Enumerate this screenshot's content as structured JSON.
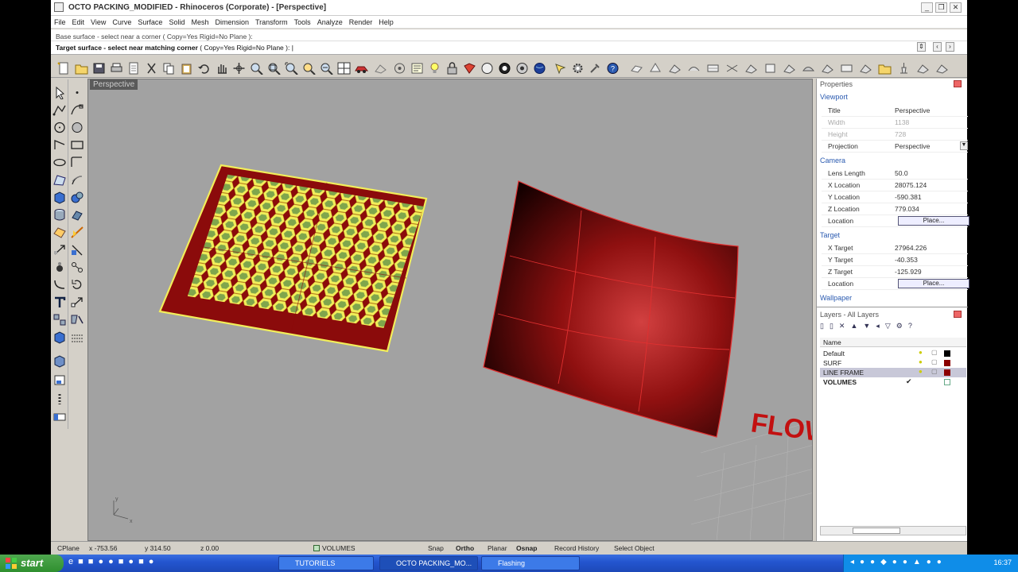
{
  "window": {
    "title": "OCTO PACKING_MODIFIED - Rhinoceros (Corporate) - [Perspective]",
    "controls": [
      "_",
      "❐",
      "✕"
    ]
  },
  "menu": [
    "File",
    "Edit",
    "View",
    "Curve",
    "Surface",
    "Solid",
    "Mesh",
    "Dimension",
    "Transform",
    "Tools",
    "Analyze",
    "Render",
    "Help"
  ],
  "command": {
    "history": "Base surface - select near a corner ( Copy=Yes  Rigid=No  Plane ):",
    "prompt_bold": "Target surface - select near matching corner",
    "prompt_rest": " ( Copy=Yes  Rigid=No  Plane ):"
  },
  "viewport": {
    "label": "Perspective",
    "text3d": "FLOW",
    "axis_x": "x",
    "axis_y": "y"
  },
  "properties": {
    "header": "Properties",
    "viewport_section": "Viewport",
    "title_label": "Title",
    "title_value": "Perspective",
    "width_label": "Width",
    "width_value": "1138",
    "height_label": "Height",
    "height_value": "728",
    "projection_label": "Projection",
    "projection_value": "Perspective",
    "camera_section": "Camera",
    "lens_label": "Lens Length",
    "lens_value": "50.0",
    "xloc_label": "X Location",
    "xloc_value": "28075.124",
    "yloc_label": "Y Location",
    "yloc_value": "-590.381",
    "zloc_label": "Z Location",
    "zloc_value": "779.034",
    "location_label": "Location",
    "place_label": "Place...",
    "target_section": "Target",
    "xtgt_label": "X Target",
    "xtgt_value": "27964.226",
    "ytgt_label": "Y Target",
    "ytgt_value": "-40.353",
    "ztgt_label": "Z Target",
    "ztgt_value": "-125.929",
    "wallpaper_section": "Wallpaper"
  },
  "layers": {
    "header": "Layers - All Layers",
    "name_col": "Name",
    "rows": [
      {
        "name": "Default",
        "color": "#000000"
      },
      {
        "name": "SURF",
        "color": "#8b0000"
      },
      {
        "name": "LINE FRAME",
        "color": "#8b0000"
      },
      {
        "name": "VOLUMES",
        "color": "#ffffff"
      }
    ],
    "current_mark": "✔"
  },
  "status": {
    "cplane": "CPlane",
    "x": "x -753.56",
    "y": "y 314.50",
    "z": "z 0.00",
    "layer": "VOLUMES",
    "snap": "Snap",
    "ortho": "Ortho",
    "planar": "Planar",
    "osnap": "Osnap",
    "record": "Record History",
    "select": "Select Object"
  },
  "taskbar": {
    "start": "start",
    "tasks": [
      "TUTORIELS",
      "OCTO PACKING_MO...",
      "Flashing"
    ],
    "clock": "16:37"
  },
  "colors": {
    "viewport_bg": "#a2a2a2",
    "surface_red": "#8b0000",
    "hex_yellow": "#f2ee5a",
    "hex_green": "#7fa64c",
    "accent_blue": "#2a5ab0"
  }
}
